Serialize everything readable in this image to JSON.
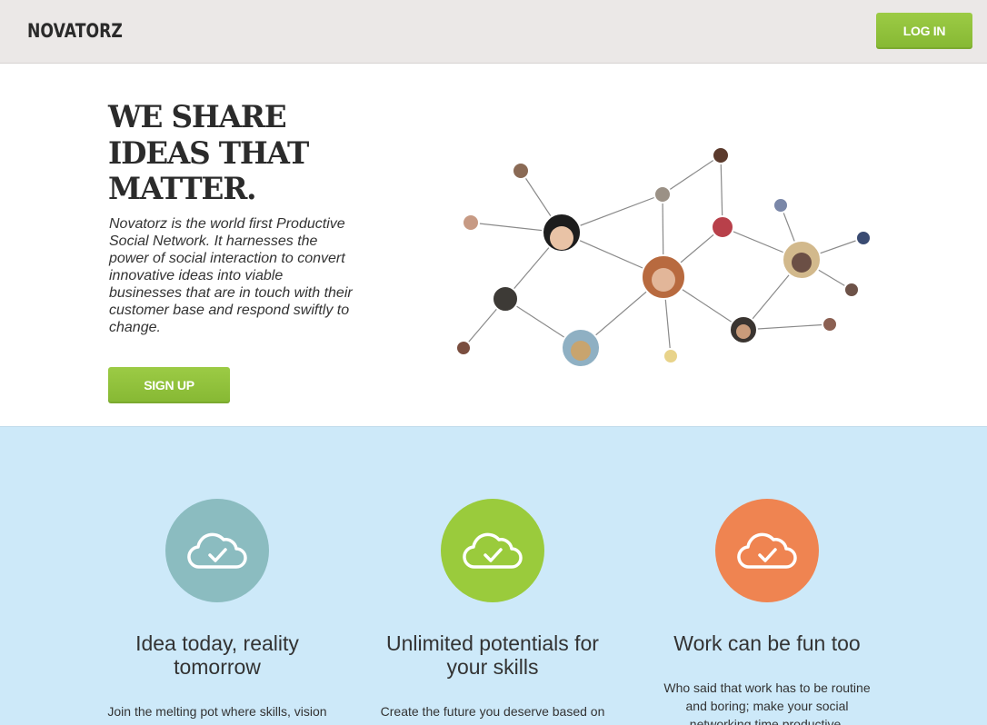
{
  "header": {
    "logo": "NOVATORZ",
    "login_label": "LOG IN"
  },
  "hero": {
    "title_line1": "WE SHARE",
    "title_line2": "IDEAS THAT",
    "title_line3": "MATTER.",
    "description": "Novatorz is the world first Productive Social Network. It harnesses the power of social interaction to convert innovative ideas into viable businesses that are in touch with their customer base and respond swiftly to change.",
    "signup_label": "SIGN UP",
    "network_icon": "social-network-graph-with-avatars"
  },
  "features": [
    {
      "icon": "cloud-check-icon",
      "color": "#8bbcc0",
      "title_line1": "Idea today, reality",
      "title_line2": "tomorrow",
      "text": "Join the melting pot where skills, vision and"
    },
    {
      "icon": "cloud-check-icon",
      "color": "#9acb3c",
      "title_line1": "Unlimited potentials for",
      "title_line2": "your skills",
      "text": "Create the future you deserve based on"
    },
    {
      "icon": "cloud-check-icon",
      "color": "#ef8451",
      "title_line1": "Work can be fun too",
      "title_line2": "",
      "text": "Who said that work has to be routine and boring; make your social networking time productive."
    }
  ],
  "colors": {
    "header_bg": "#ebe8e7",
    "accent_green": "#8fc13a",
    "features_bg": "#cde9f9"
  }
}
